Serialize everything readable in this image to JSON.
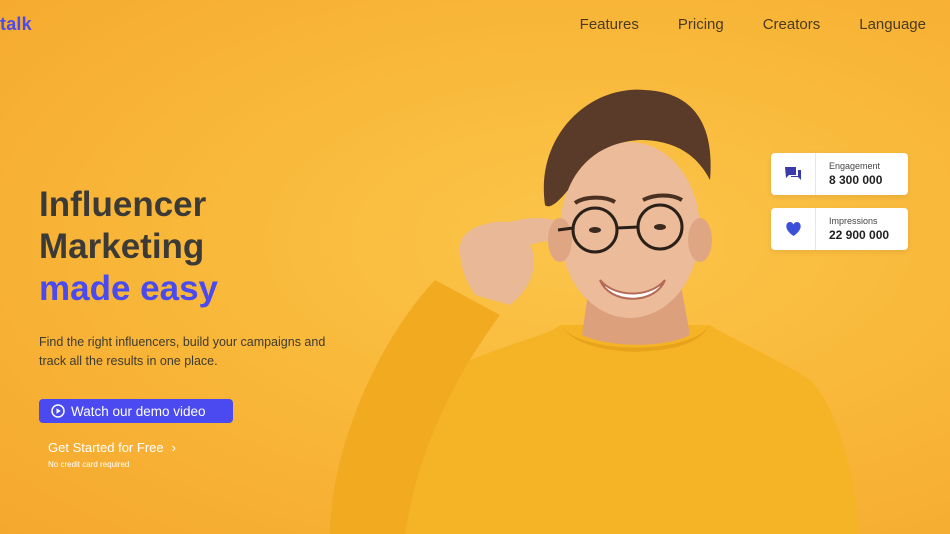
{
  "brand": {
    "logo_text": "talk"
  },
  "nav": {
    "items": [
      "Features",
      "Pricing",
      "Creators",
      "Language"
    ]
  },
  "hero": {
    "title_line1": "Influencer",
    "title_line2": "Marketing",
    "title_accent": "made easy",
    "description": "Find the right influencers, build your campaigns and track all the results in one place.",
    "demo_button_label": "Watch our demo video",
    "cta_label": "Get Started for Free",
    "cta_note": "No credit card required"
  },
  "stats": [
    {
      "icon": "chat-icon",
      "label": "Engagement",
      "value": "8 300 000"
    },
    {
      "icon": "heart-icon",
      "label": "Impressions",
      "value": "22 900 000"
    }
  ],
  "colors": {
    "accent": "#4a4af0",
    "background": "#f9b93a",
    "shirt": "#f5b326"
  }
}
